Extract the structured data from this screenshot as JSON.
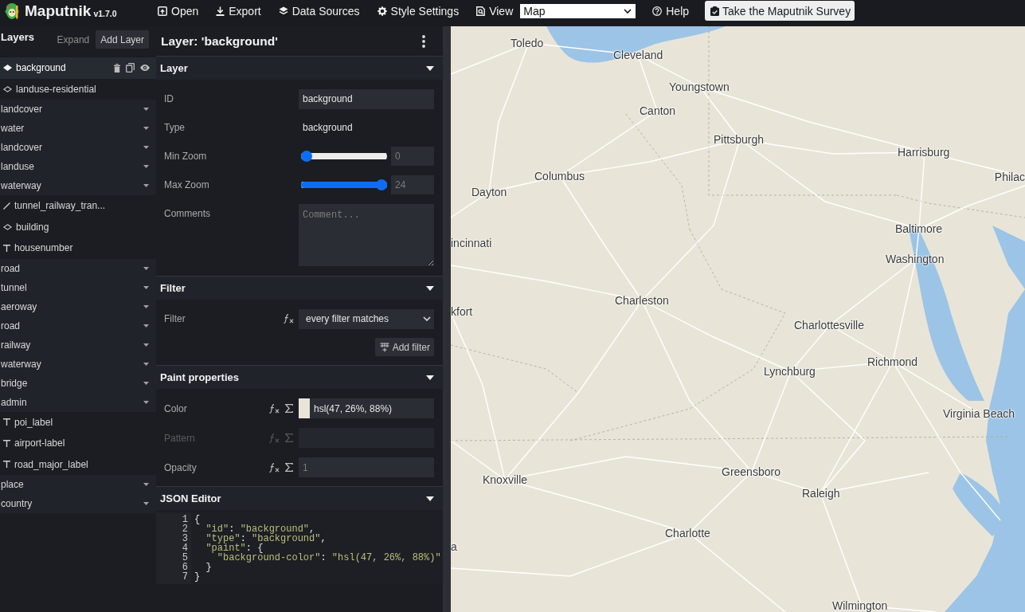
{
  "toolbar": {
    "app_name": "Maputnik",
    "version": "v1.7.0",
    "menu": [
      {
        "label": "Open"
      },
      {
        "label": "Export"
      },
      {
        "label": "Data Sources"
      },
      {
        "label": "Style Settings"
      }
    ],
    "view": {
      "label": "View",
      "value": "Map"
    },
    "help": "Help",
    "survey_button": "Take the Maputnik Survey"
  },
  "layers_panel": {
    "title": "Layers",
    "expand_button": "Expand",
    "add_button": "Add Layer",
    "items": [
      {
        "kind": "background",
        "label": "background",
        "selected": true
      },
      {
        "kind": "fill",
        "label": "landuse-residential",
        "selected": false
      },
      {
        "kind": "group",
        "label": "landcover",
        "selected": false,
        "expanded": false
      },
      {
        "kind": "group",
        "label": "water",
        "selected": false,
        "expanded": false
      },
      {
        "kind": "group",
        "label": "landcover",
        "selected": false,
        "expanded": false
      },
      {
        "kind": "group",
        "label": "landuse",
        "selected": false,
        "expanded": false
      },
      {
        "kind": "group",
        "label": "waterway",
        "selected": false,
        "expanded": false
      },
      {
        "kind": "line",
        "label": "tunnel_railway_tran...",
        "selected": false
      },
      {
        "kind": "fill",
        "label": "building",
        "selected": false
      },
      {
        "kind": "symbol",
        "label": "housenumber",
        "selected": false
      },
      {
        "kind": "group",
        "label": "road",
        "selected": false,
        "expanded": false
      },
      {
        "kind": "group",
        "label": "tunnel",
        "selected": false,
        "expanded": false
      },
      {
        "kind": "group",
        "label": "aeroway",
        "selected": false,
        "expanded": false
      },
      {
        "kind": "group",
        "label": "road",
        "selected": false,
        "expanded": false
      },
      {
        "kind": "group",
        "label": "railway",
        "selected": false,
        "expanded": false
      },
      {
        "kind": "group",
        "label": "waterway",
        "selected": false,
        "expanded": false
      },
      {
        "kind": "group",
        "label": "bridge",
        "selected": false,
        "expanded": false
      },
      {
        "kind": "group",
        "label": "admin",
        "selected": false,
        "expanded": false
      },
      {
        "kind": "symbol",
        "label": "poi_label",
        "selected": false
      },
      {
        "kind": "symbol",
        "label": "airport-label",
        "selected": false
      },
      {
        "kind": "symbol",
        "label": "road_major_label",
        "selected": false
      },
      {
        "kind": "group",
        "label": "place",
        "selected": false,
        "expanded": false
      },
      {
        "kind": "group",
        "label": "country",
        "selected": false,
        "expanded": false
      }
    ]
  },
  "editor": {
    "title": "Layer: 'background'",
    "sections": [
      {
        "kind": "layer",
        "title": "Layer",
        "expanded": true,
        "fields": [
          {
            "kind": "input",
            "label": "ID",
            "value": "background"
          },
          {
            "kind": "static",
            "label": "Type",
            "value": "background"
          },
          {
            "kind": "slider",
            "label": "Min Zoom",
            "level": 0,
            "placeholder": "0"
          },
          {
            "kind": "slider",
            "label": "Max Zoom",
            "level": 1,
            "placeholder": "24"
          },
          {
            "kind": "textarea",
            "label": "Comments",
            "placeholder": "Comment..."
          }
        ]
      },
      {
        "kind": "filter",
        "title": "Filter",
        "expanded": true,
        "fields": [
          {
            "kind": "select",
            "label": "Filter",
            "value": "every filter matches"
          },
          {
            "kind": "button",
            "label": "Add filter"
          }
        ]
      },
      {
        "kind": "paint",
        "title": "Paint properties",
        "expanded": true,
        "fields": [
          {
            "kind": "color",
            "label": "Color",
            "value": "hsl(47, 26%, 88%)",
            "disabled": false
          },
          {
            "kind": "input",
            "label": "Pattern",
            "disabled": true
          },
          {
            "kind": "number",
            "label": "Opacity",
            "placeholder": "1",
            "disabled": false
          }
        ]
      },
      {
        "kind": "json",
        "title": "JSON Editor",
        "expanded": true,
        "lines": [
          {
            "number": "1",
            "text": "{"
          },
          {
            "number": "2",
            "text": "  \"id\": \"background\","
          },
          {
            "number": "3",
            "text": "  \"type\": \"background\","
          },
          {
            "number": "4",
            "text": "  \"paint\": {"
          },
          {
            "number": "5",
            "text": "    \"background-color\": \"hsl(47, 26%, 88%)\""
          },
          {
            "number": "6",
            "text": "  }"
          },
          {
            "number": "7",
            "text": "}"
          }
        ]
      }
    ]
  },
  "map": {
    "labels": [
      "Toledo",
      "Cleveland",
      "Youngstown",
      "Canton",
      "Pittsburgh",
      "Harrisburg",
      "Columbus",
      "Philac",
      "Dayton",
      "Baltimore",
      "incinnati",
      "Washington",
      "Charleston",
      "kfort",
      "Charlottesville",
      "Richmond",
      "Lynchburg",
      "Virginia Beach",
      "Greensboro",
      "Knoxville",
      "Raleigh",
      "Charlotte",
      "a",
      "Wilmington"
    ]
  }
}
